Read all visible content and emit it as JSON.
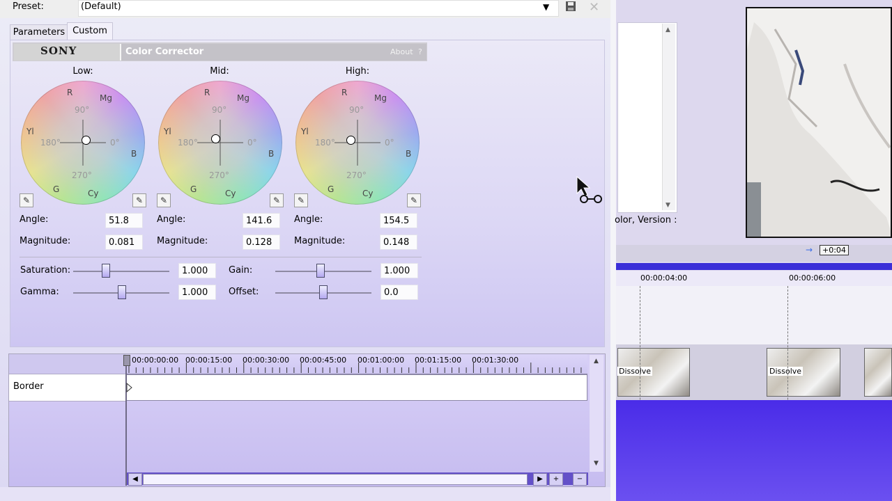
{
  "preset": {
    "label": "Preset:",
    "value": "(Default)"
  },
  "tabs": {
    "parameters": "Parameters",
    "custom": "Custom"
  },
  "plugin": {
    "vendor": "SONY",
    "title": "Color Corrector",
    "about": "About",
    "about_q": "?"
  },
  "wheel_labels": {
    "r": "R",
    "mg": "Mg",
    "yl": "Yl",
    "b": "B",
    "g": "G",
    "cy": "Cy",
    "a90": "90°",
    "a180": "180°",
    "a0": "0°",
    "a270": "270°"
  },
  "wheels": [
    {
      "title": "Low:",
      "angle_label": "Angle:",
      "angle": "51.8",
      "magnitude_label": "Magnitude:",
      "magnitude": "0.081"
    },
    {
      "title": "Mid:",
      "angle_label": "Angle:",
      "angle": "141.6",
      "magnitude_label": "Magnitude:",
      "magnitude": "0.128"
    },
    {
      "title": "High:",
      "angle_label": "Angle:",
      "angle": "154.5",
      "magnitude_label": "Magnitude:",
      "magnitude": "0.148"
    }
  ],
  "sliders": {
    "saturation": {
      "label": "Saturation:",
      "value": "1.000",
      "level": 0.33
    },
    "gamma": {
      "label": "Gamma:",
      "value": "1.000",
      "level": 0.5
    },
    "gain": {
      "label": "Gain:",
      "value": "1.000",
      "level": 0.47
    },
    "offset": {
      "label": "Offset:",
      "value": "0.0",
      "level": 0.5
    }
  },
  "keyframes": {
    "ticks": [
      "00:00:00:00",
      "00:00:15:00",
      "00:00:30:00",
      "00:00:45:00",
      "00:01:00:00",
      "00:01:15:00",
      "00:01:30:00"
    ],
    "row_label": "Border"
  },
  "right": {
    "list_caption": "olor, Version :",
    "offset_badge": "+0:04",
    "timeline_ticks": [
      "00:00:04:00",
      "00:00:06:00"
    ],
    "dissolve_label": "Dissolve"
  },
  "colors": {
    "accent": "#3b2fd8",
    "panel": "#dcd7f5",
    "timeline_purple": "#5a3cec"
  }
}
